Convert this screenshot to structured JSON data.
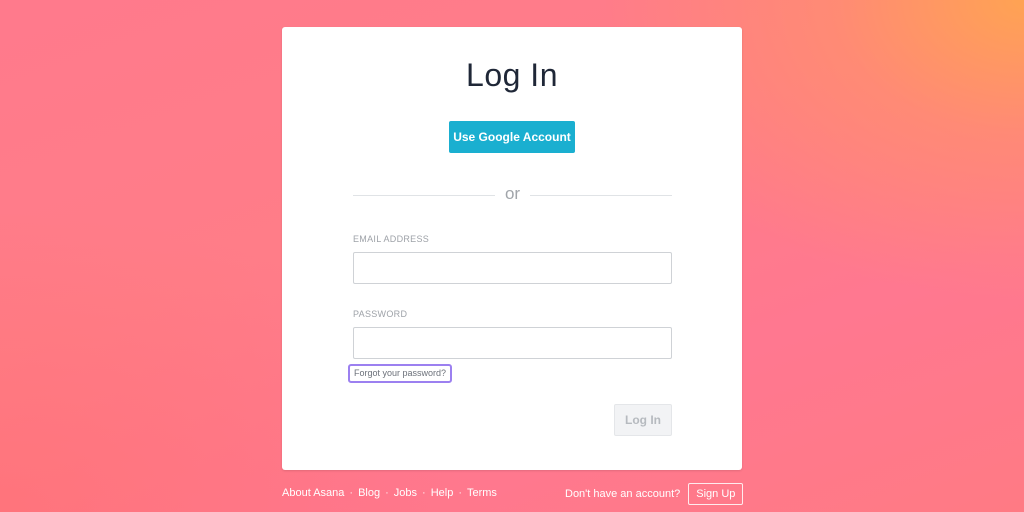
{
  "theme": {
    "background_primary": "#ff7a8c",
    "background_accent": "#ffa050",
    "card_background": "#ffffff",
    "google_button_color": "#1aafd0",
    "focus_ring_color": "#9c80f0",
    "title_color": "#1f2737"
  },
  "login_card": {
    "title": "Log In",
    "google_button_label": "Use Google Account",
    "divider_text": "or",
    "email": {
      "label": "EMAIL ADDRESS",
      "value": "",
      "placeholder": ""
    },
    "password": {
      "label": "PASSWORD",
      "value": "",
      "placeholder": ""
    },
    "forgot_password_label": "Forgot your password?",
    "submit_label": "Log In",
    "submit_disabled": true
  },
  "footer": {
    "links": [
      {
        "label": "About Asana"
      },
      {
        "label": "Blog"
      },
      {
        "label": "Jobs"
      },
      {
        "label": "Help"
      },
      {
        "label": "Terms"
      }
    ],
    "separator": "·",
    "signup_prompt": "Don't have an account?",
    "signup_label": "Sign Up"
  }
}
